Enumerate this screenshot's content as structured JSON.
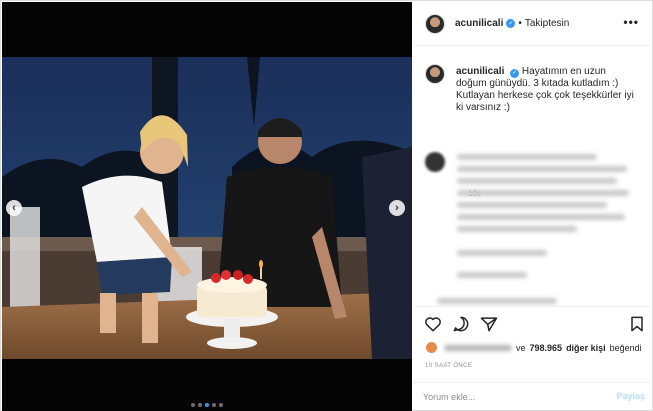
{
  "header": {
    "username": "acunilicali",
    "separator": "•",
    "follow_status": "Takiptesin",
    "more_icon": "ellipsis-icon"
  },
  "caption": {
    "username": "acunilicali",
    "text": "Hayatımın en uzun doğum günüydü. 3 kıtada kutladım :) Kutlayan herkese çok çok teşekkürler iyi ki varsınız :)",
    "time": "10s"
  },
  "carousel": {
    "prev_icon": "chevron-left-icon",
    "next_icon": "chevron-right-icon",
    "prev_glyph": "‹",
    "next_glyph": "›",
    "total_slides": 5,
    "active_slide": 3
  },
  "actions": {
    "like_icon": "heart-icon",
    "comment_icon": "comment-icon",
    "share_icon": "share-icon",
    "save_icon": "bookmark-icon"
  },
  "likes": {
    "connector": "ve",
    "count": "798.965",
    "suffix": "diğer kişi",
    "verb": "beğendi"
  },
  "post_time": "10 SAAT ÖNCE",
  "comment": {
    "placeholder": "Yorum ekle...",
    "post_label": "Paylaş"
  },
  "colors": {
    "verified": "#3897f0",
    "active_dot": "#2f9ee8",
    "post_button": "#b2dffc"
  }
}
